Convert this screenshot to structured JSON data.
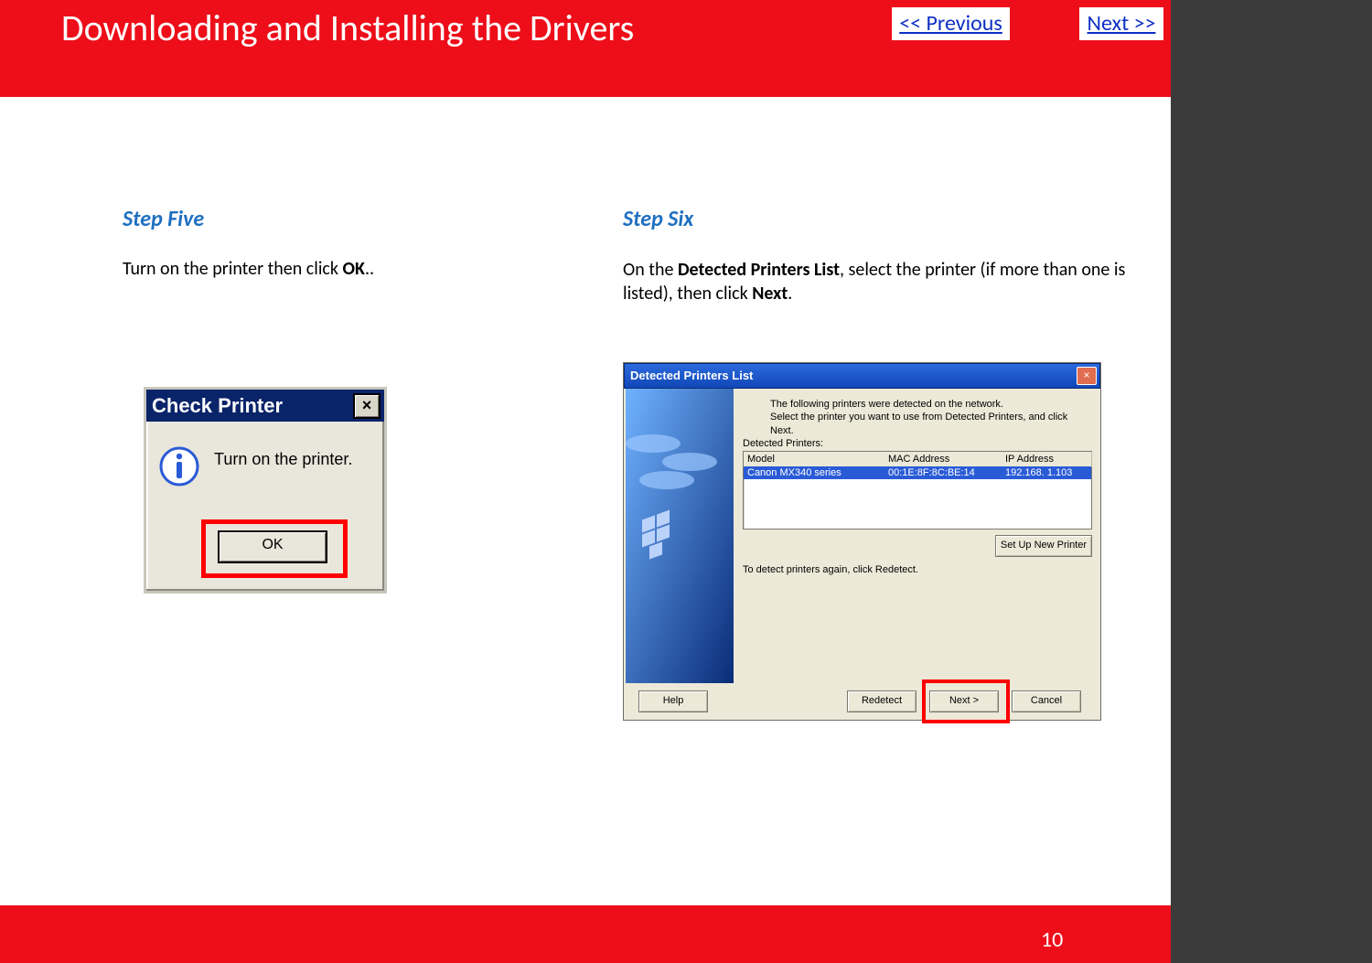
{
  "header": {
    "title": "Downloading and Installing  the Drivers",
    "prev_label": " << Previous",
    "next_label": "Next >>"
  },
  "step5": {
    "heading": "Step Five",
    "text_before": "Turn on the printer then click ",
    "text_bold": "OK",
    "text_after": "..",
    "dialog": {
      "title": "Check Printer",
      "close": "×",
      "message": "Turn on the printer.",
      "ok": "OK"
    }
  },
  "step6": {
    "heading": "Step Six",
    "text_before": "On the ",
    "text_bold1": "Detected Printers List",
    "text_mid": ", select the printer (if more than one is listed), then click ",
    "text_bold2": "Next",
    "text_after": ".",
    "dialog": {
      "title": "Detected Printers List",
      "close": "×",
      "intro": "The following printers were detected on the network.\nSelect the printer you want to use from Detected Printers, and click Next.",
      "detected_label": "Detected Printers:",
      "columns": {
        "c1": "Model",
        "c2": "MAC Address",
        "c3": "IP Address"
      },
      "row": {
        "model": "Canon MX340 series",
        "mac": "00:1E:8F:8C:BE:14",
        "ip": "192.168. 1.103"
      },
      "setup_new": "Set Up New Printer",
      "redetect_note": "To detect printers again, click Redetect.",
      "buttons": {
        "help": "Help",
        "redetect": "Redetect",
        "next": "Next >",
        "cancel": "Cancel"
      }
    }
  },
  "footer": {
    "page_number": "10"
  }
}
